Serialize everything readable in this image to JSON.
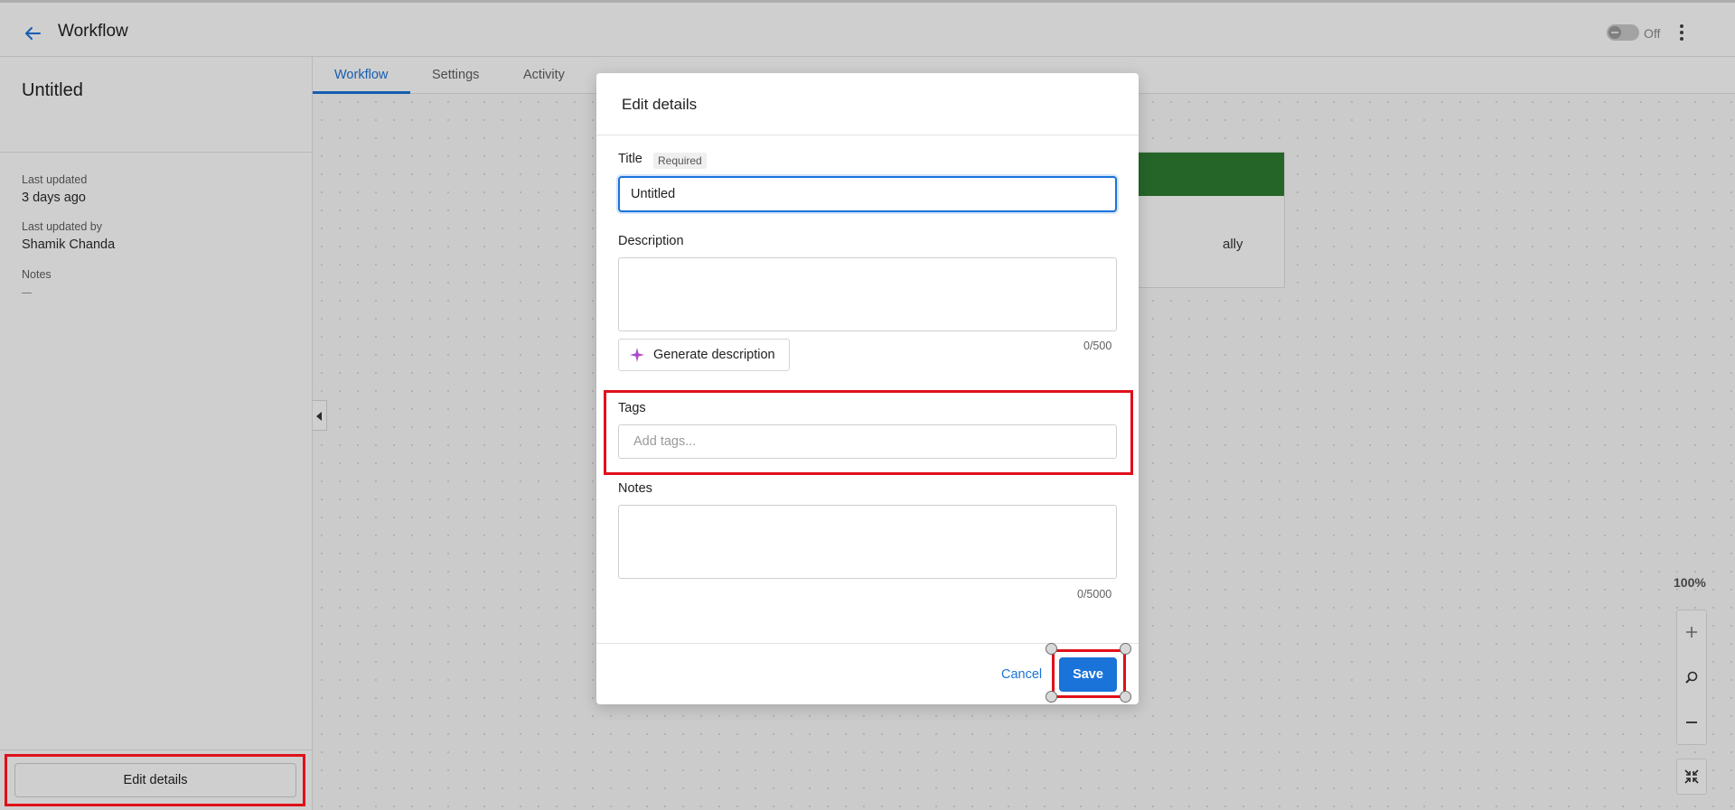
{
  "header": {
    "title": "Workflow",
    "toggle_label": "Off",
    "back_icon": "arrow-left-icon",
    "menu_icon": "kebab-menu-icon"
  },
  "sidebar": {
    "title": "Untitled",
    "last_updated_label": "Last updated",
    "last_updated_value": "3 days ago",
    "last_updated_by_label": "Last updated by",
    "last_updated_by_value": "Shamik Chanda",
    "notes_label": "Notes",
    "edit_details_label": "Edit details"
  },
  "tabs": [
    {
      "label": "Workflow",
      "active": true
    },
    {
      "label": "Settings",
      "active": false
    },
    {
      "label": "Activity",
      "active": false
    }
  ],
  "canvas": {
    "node_partial_text": "ally",
    "node_header_color": "#2e7d32",
    "zoom_level": "100%"
  },
  "modal": {
    "title": "Edit details",
    "title_label": "Title",
    "required_badge": "Required",
    "title_value": "Untitled",
    "description_label": "Description",
    "description_counter": "0/500",
    "generate_label": "Generate description",
    "tags_label": "Tags",
    "tags_placeholder": "Add tags...",
    "notes_label": "Notes",
    "notes_counter": "0/5000",
    "cancel_label": "Cancel",
    "save_label": "Save"
  },
  "colors": {
    "accent": "#1a73d9",
    "highlight": "#e0101a"
  }
}
